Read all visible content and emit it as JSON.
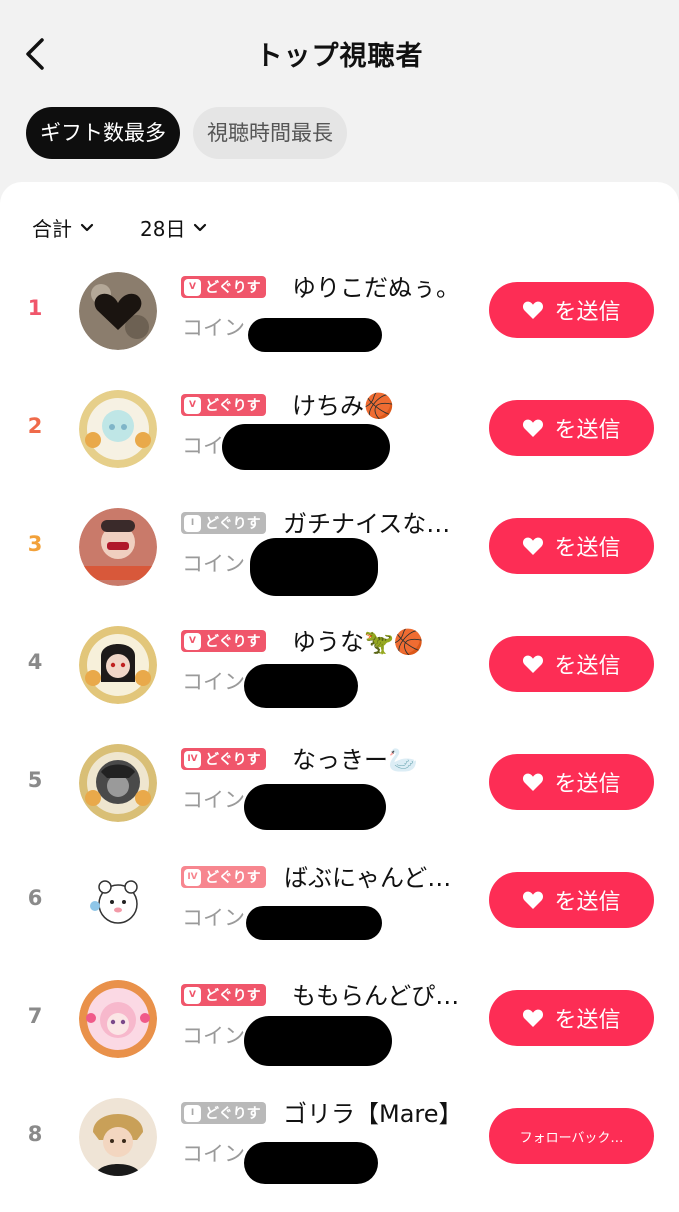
{
  "header": {
    "title": "トップ視聴者"
  },
  "tabs": [
    {
      "label": "ギフト数最多"
    },
    {
      "label": "視聴時間最長"
    }
  ],
  "filters": [
    {
      "label": "合計"
    },
    {
      "label": "28日"
    }
  ],
  "colors": {
    "accent": "#fd2d55",
    "rank1": "#f0566b",
    "rank2": "#ef6a4a",
    "rank3": "#f2a13a",
    "rank_default": "#8a8a8a"
  },
  "viewers": [
    {
      "rank": "1",
      "badge": "どぐりす",
      "name": "ゆりこだぬぅ。",
      "coin_label": "コイン",
      "action": "を送信"
    },
    {
      "rank": "2",
      "badge": "どぐりす",
      "name": "けちみ🏀",
      "coin_label": "コイン",
      "action": "を送信"
    },
    {
      "rank": "3",
      "badge": "どぐりす",
      "name": "ガチナイスな…",
      "coin_label": "コイン",
      "action": "を送信"
    },
    {
      "rank": "4",
      "badge": "どぐりす",
      "name": "ゆうな🦖🏀",
      "coin_label": "コイン",
      "action": "を送信"
    },
    {
      "rank": "5",
      "badge": "どぐりす",
      "name": "なっきー🦢",
      "coin_label": "コイン",
      "action": "を送信"
    },
    {
      "rank": "6",
      "badge": "どぐりす",
      "name": "ばぶにゃんど…",
      "coin_label": "コイン",
      "action": "を送信"
    },
    {
      "rank": "7",
      "badge": "どぐりす",
      "name": "ももらんどぴ…",
      "coin_label": "コイン",
      "action": "を送信"
    },
    {
      "rank": "8",
      "badge": "どぐりす",
      "name": "ゴリラ【Mare】",
      "coin_label": "コイン",
      "action": "フォローバック…"
    }
  ]
}
